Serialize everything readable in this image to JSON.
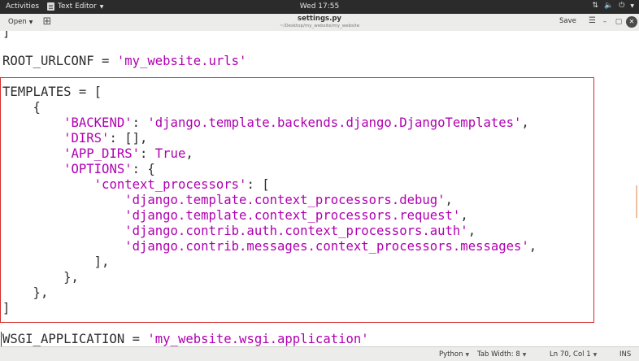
{
  "topbar": {
    "activities": "Activities",
    "app_name": "Text Editor",
    "clock": "Wed 17:55"
  },
  "header": {
    "open_label": "Open",
    "title": "settings.py",
    "subtitle": "~/Desktop/my_website/my_website",
    "save_label": "Save"
  },
  "code": {
    "line0": "]",
    "line1_a": "ROOT_URLCONF = ",
    "line1_b": "'my_website.urls'",
    "line2": "TEMPLATES = [",
    "line3": "    {",
    "line4_a": "'BACKEND'",
    "line4_b": ": ",
    "line4_c": "'django.template.backends.django.DjangoTemplates'",
    "line4_d": ",",
    "line5_a": "'DIRS'",
    "line5_b": ": [],",
    "line6_a": "'APP_DIRS'",
    "line6_b": ": ",
    "line6_c": "True",
    "line6_d": ",",
    "line7_a": "'OPTIONS'",
    "line7_b": ": {",
    "line8_a": "'context_processors'",
    "line8_b": ": [",
    "line9_a": "'django.template.context_processors.debug'",
    "line9_b": ",",
    "line10_a": "'django.template.context_processors.request'",
    "line10_b": ",",
    "line11_a": "'django.contrib.auth.context_processors.auth'",
    "line11_b": ",",
    "line12_a": "'django.contrib.messages.context_processors.messages'",
    "line12_b": ",",
    "line13": "            ],",
    "line14": "        },",
    "line15": "    },",
    "line16": "]",
    "line17_a": "WSGI_APPLICATION = ",
    "line17_b": "'my_website.wsgi.application'"
  },
  "statusbar": {
    "language": "Python",
    "tab_width": "Tab Width: 8",
    "position": "Ln 70, Col 1",
    "mode": "INS"
  },
  "colors": {
    "string": "#b000b0",
    "highlight_box": "#d62a2a",
    "topbar": "#2b2b2b"
  }
}
